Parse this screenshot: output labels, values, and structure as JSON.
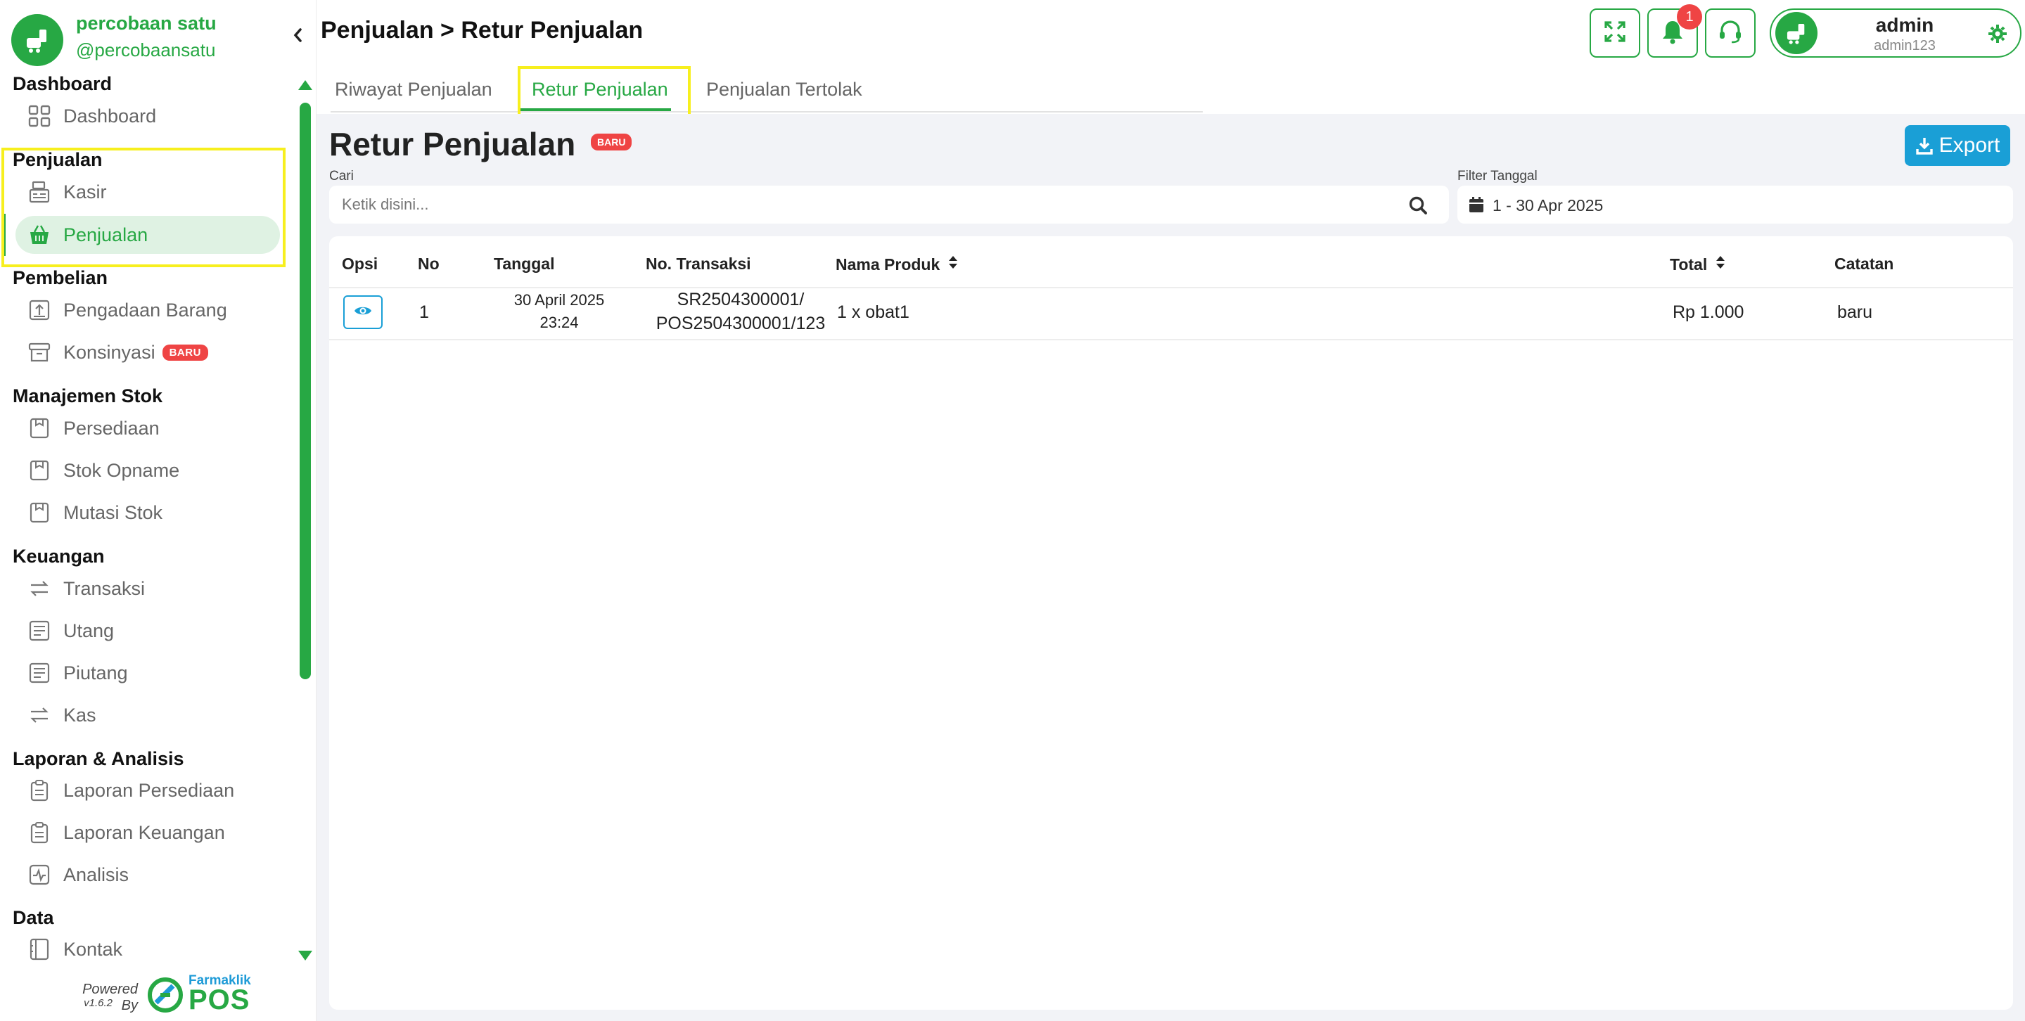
{
  "sidebar": {
    "brand_name": "percobaan satu",
    "brand_handle": "@percobaansatu",
    "sections": {
      "dashboard": "Dashboard",
      "penjualan": "Penjualan",
      "pembelian": "Pembelian",
      "manajemen_stok": "Manajemen Stok",
      "keuangan": "Keuangan",
      "laporan": "Laporan & Analisis",
      "data": "Data"
    },
    "items": {
      "dashboard": "Dashboard",
      "kasir": "Kasir",
      "penjualan": "Penjualan",
      "pengadaan": "Pengadaan Barang",
      "konsinyasi": "Konsinyasi",
      "konsinyasi_badge": "BARU",
      "persediaan": "Persediaan",
      "stok_opname": "Stok Opname",
      "mutasi_stok": "Mutasi Stok",
      "transaksi": "Transaksi",
      "utang": "Utang",
      "piutang": "Piutang",
      "kas": "Kas",
      "laporan_persediaan": "Laporan Persediaan",
      "laporan_keuangan": "Laporan Keuangan",
      "analisis": "Analisis",
      "kontak": "Kontak"
    },
    "powered_by": "Powered By",
    "version": "v1.6.2",
    "powered_brand": "Farmaklik",
    "powered_pos": "POS"
  },
  "topbar": {
    "title": "Penjualan > Retur Penjualan",
    "notification_count": "1",
    "user_name": "admin",
    "user_id": "admin123"
  },
  "tabs": [
    "Riwayat Penjualan",
    "Retur Penjualan",
    "Penjualan Tertolak"
  ],
  "main": {
    "heading": "Retur Penjualan",
    "heading_badge": "BARU",
    "export_label": "Export",
    "search_label": "Cari",
    "search_placeholder": "Ketik disini...",
    "date_label": "Filter Tanggal",
    "date_value": "1 - 30 Apr 2025"
  },
  "table": {
    "headers": [
      "Opsi",
      "No",
      "Tanggal",
      "No. Transaksi",
      "Nama Produk",
      "Total",
      "Catatan"
    ],
    "rows": [
      {
        "no": "1",
        "date": "30 April 2025",
        "time": "23:24",
        "trx_line1": "SR2504300001/",
        "trx_line2": "POS2504300001/123",
        "product": "1 x obat1",
        "total": "Rp 1.000",
        "note": "baru"
      }
    ]
  },
  "colors": {
    "brand_green": "#27a844",
    "export_blue": "#1a9fd6",
    "badge_red": "#ef4444",
    "highlight_yellow": "#f7ef1e",
    "content_bg": "#f2f3f7"
  },
  "icons": [
    "collapse-chevron-icon",
    "grid-icon",
    "cash-register-icon",
    "basket-icon",
    "box-upload-icon",
    "archive-icon",
    "stock-icon",
    "transfer-icon",
    "list-icon",
    "clipboard-icon",
    "activity-icon",
    "contact-icon",
    "expand-icon",
    "bell-icon",
    "headset-icon",
    "gear-icon",
    "download-icon",
    "search-icon",
    "calendar-icon",
    "eye-icon",
    "sort-icon"
  ]
}
